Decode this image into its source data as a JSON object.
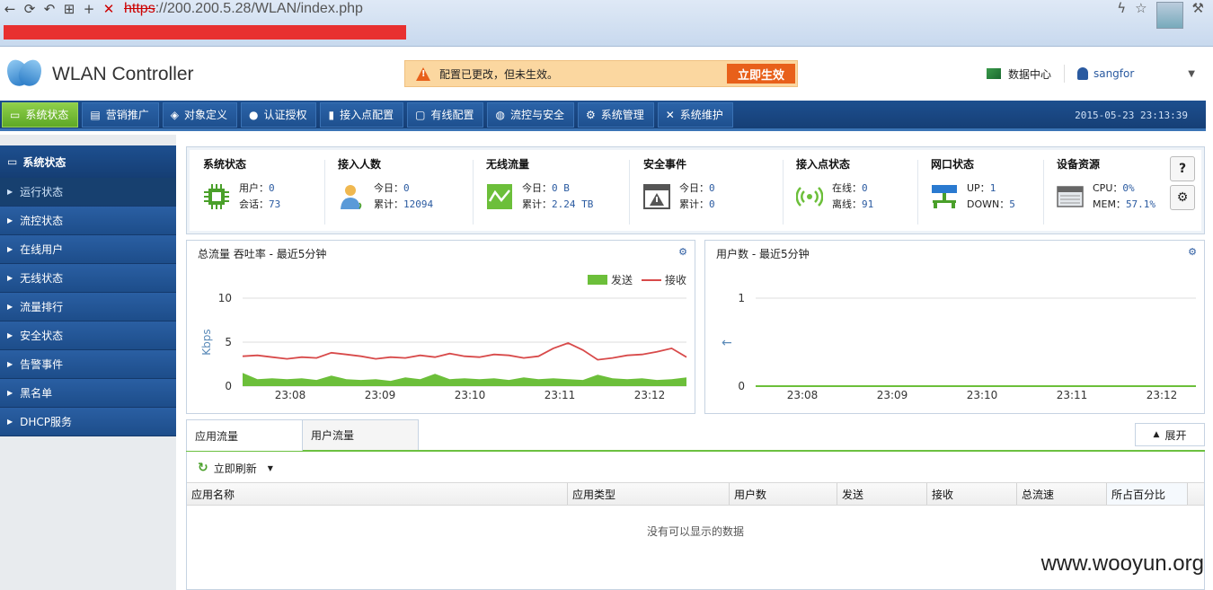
{
  "browser": {
    "url_proto": "https",
    "url_rest": "://200.200.5.28/WLAN/index.php"
  },
  "header": {
    "title": "WLAN Controller",
    "notice": "配置已更改，但未生效。",
    "apply_label": "立即生效",
    "datacenter": "数据中心",
    "username": "sangfor"
  },
  "nav": {
    "items": [
      "系统状态",
      "营销推广",
      "对象定义",
      "认证授权",
      "接入点配置",
      "有线配置",
      "流控与安全",
      "系统管理",
      "系统维护"
    ],
    "icons": [
      "monitor-icon",
      "megaphone-icon",
      "cube-icon",
      "user-icon",
      "signal-bars-icon",
      "wired-box-icon",
      "globe-icon",
      "gear-icon",
      "tools-icon"
    ],
    "clock": "2015-05-23 23:13:39"
  },
  "sidebar": {
    "title": "系统状态",
    "items": [
      "运行状态",
      "流控状态",
      "在线用户",
      "无线状态",
      "流量排行",
      "安全状态",
      "告警事件",
      "黑名单",
      "DHCP服务"
    ]
  },
  "summary": {
    "sys": {
      "title": "系统状态",
      "l1": "用户：",
      "v1": "0",
      "l2": "会话：",
      "v2": "73"
    },
    "users": {
      "title": "接入人数",
      "l1": "今日：",
      "v1": "0",
      "l2": "累计：",
      "v2": "12094"
    },
    "traffic": {
      "title": "无线流量",
      "l1": "今日：",
      "v1": "0 B",
      "l2": "累计：",
      "v2": "2.24 TB"
    },
    "security": {
      "title": "安全事件",
      "l1": "今日：",
      "v1": "0",
      "l2": "累计：",
      "v2": "0"
    },
    "ap": {
      "title": "接入点状态",
      "l1": "在线：",
      "v1": "0",
      "l2": "离线：",
      "v2": "91"
    },
    "port": {
      "title": "网口状态",
      "l1": "UP：",
      "v1": "1",
      "l2": "DOWN：",
      "v2": "5"
    },
    "res": {
      "title": "设备资源",
      "l1": "CPU：",
      "v1": "0%",
      "l2": "MEM：",
      "v2": "57.1%"
    },
    "help": "?"
  },
  "colors": {
    "send": "#6cbf3a",
    "recv": "#d84a4a",
    "nav_bg": "#1d4f8f",
    "accent_green": "#6cc040"
  },
  "chart_data": [
    {
      "type": "area",
      "title": "总流量 吞吐率 - 最近5分钟",
      "ylabel": "Kbps",
      "xlabel": "",
      "ylim": [
        0,
        10
      ],
      "yticks": [
        0,
        5,
        10
      ],
      "x_ticks": [
        "23:08",
        "23:09",
        "23:10",
        "23:11",
        "23:12"
      ],
      "legend": "top-right",
      "series": [
        {
          "name": "发送",
          "values": [
            1.5,
            0.8,
            0.9,
            0.8,
            0.9,
            0.7,
            1.2,
            0.8,
            0.7,
            0.8,
            0.6,
            1.0,
            0.8,
            1.4,
            0.8,
            0.9,
            0.8,
            0.9,
            0.7,
            1.0,
            0.8,
            0.9,
            0.8,
            0.7,
            1.3,
            0.9,
            0.8,
            0.9,
            0.7,
            0.8,
            1.0
          ]
        },
        {
          "name": "接收",
          "values": [
            3.4,
            3.5,
            3.3,
            3.1,
            3.3,
            3.2,
            3.8,
            3.6,
            3.4,
            3.1,
            3.3,
            3.2,
            3.5,
            3.3,
            3.7,
            3.4,
            3.3,
            3.6,
            3.5,
            3.2,
            3.4,
            4.3,
            4.9,
            4.1,
            3.0,
            3.2,
            3.5,
            3.6,
            3.9,
            4.3,
            3.3
          ]
        }
      ]
    },
    {
      "type": "line",
      "title": "用户数 - 最近5分钟",
      "ylim": [
        0,
        1
      ],
      "yticks": [
        0,
        1
      ],
      "x_ticks": [
        "23:08",
        "23:09",
        "23:10",
        "23:11",
        "23:12"
      ],
      "series": [
        {
          "values": [
            0,
            0,
            0,
            0,
            0,
            0
          ]
        }
      ]
    }
  ],
  "tabs": {
    "items": [
      "应用流量",
      "用户流量"
    ],
    "expand": "展开",
    "refresh": "立即刷新"
  },
  "table": {
    "columns": [
      "应用名称",
      "应用类型",
      "用户数",
      "发送",
      "接收",
      "总流速",
      "所占百分比"
    ],
    "empty": "没有可以显示的数据"
  },
  "watermark": "www.wooyun.org"
}
